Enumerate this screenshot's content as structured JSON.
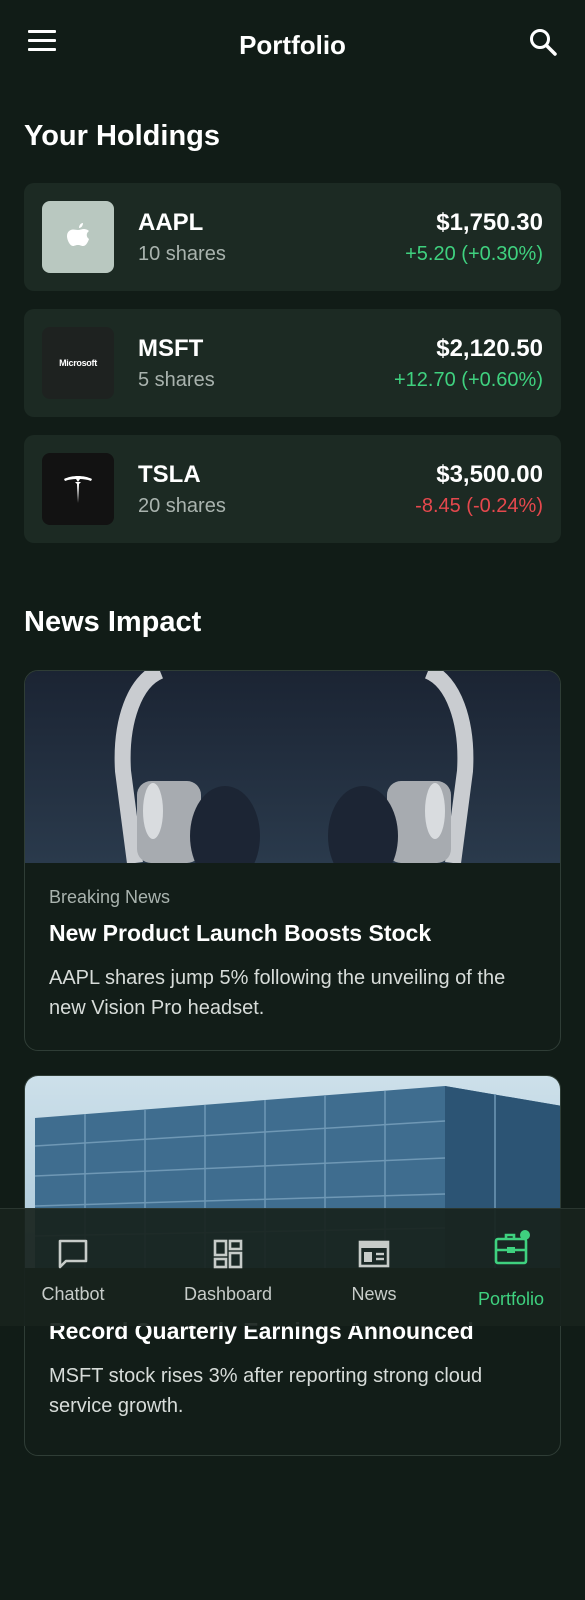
{
  "header": {
    "title": "Portfolio"
  },
  "holdings_section": {
    "title": "Your Holdings"
  },
  "holdings": [
    {
      "ticker": "AAPL",
      "shares": "10 shares",
      "price": "$1,750.30",
      "change": "+5.20 (+0.30%)",
      "direction": "up",
      "logo": "apple-logo-icon"
    },
    {
      "ticker": "MSFT",
      "shares": "5 shares",
      "price": "$2,120.50",
      "change": "+12.70 (+0.60%)",
      "direction": "up",
      "logo_text": "Microsoft"
    },
    {
      "ticker": "TSLA",
      "shares": "20 shares",
      "price": "$3,500.00",
      "change": "-8.45 (-0.24%)",
      "direction": "down",
      "logo": "tesla-logo-icon"
    }
  ],
  "news_section": {
    "title": "News Impact"
  },
  "news": [
    {
      "category": "Breaking News",
      "title": "New Product Launch Boosts Stock",
      "summary": "AAPL shares jump 5% following the unveiling of the new Vision Pro headset.",
      "image": "headphones-photo"
    },
    {
      "category": "",
      "title": "Record Quarterly Earnings Announced",
      "summary": "MSFT stock rises 3% after reporting strong cloud service growth.",
      "image": "office-building-photo"
    }
  ],
  "nav": {
    "items": [
      {
        "label": "Chatbot",
        "icon": "chat-icon"
      },
      {
        "label": "Dashboard",
        "icon": "dashboard-icon"
      },
      {
        "label": "News",
        "icon": "newspaper-icon"
      },
      {
        "label": "Portfolio",
        "icon": "briefcase-icon",
        "active": true
      }
    ]
  },
  "colors": {
    "background": "#111c17",
    "card": "#1c2a23",
    "positive": "#3fd17f",
    "negative": "#e5484d",
    "accent": "#3fd17f"
  }
}
